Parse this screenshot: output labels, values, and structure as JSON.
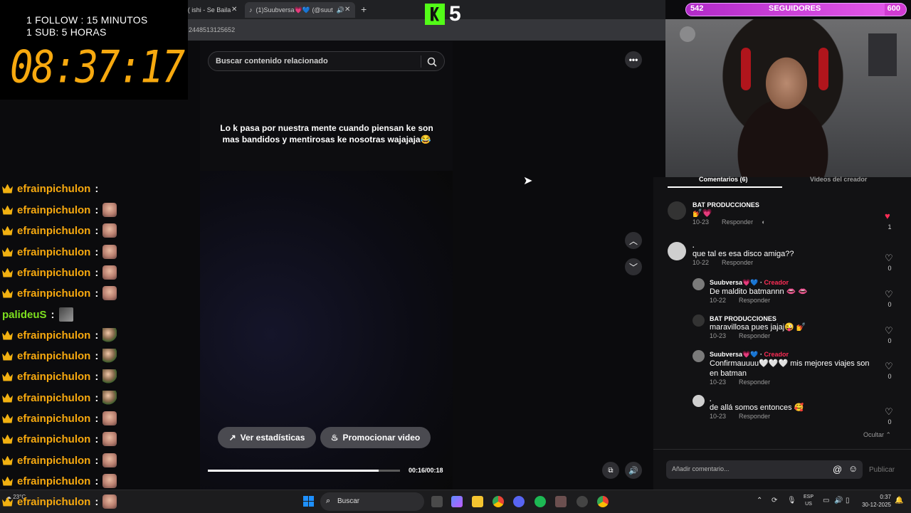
{
  "browser": {
    "tabs": [
      {
        "label": "( ishi - Se Baila"
      },
      {
        "label": "(1)Suubversa💗💙 (@suut"
      }
    ],
    "url": "2448513125652"
  },
  "overlay": {
    "rule1": "1 FOLLOW : 15 MINUTOS",
    "rule2": "1 SUB: 5 HORAS",
    "timer": "08:37:17",
    "kick_count": "5",
    "followers": {
      "current": "542",
      "label": "SEGUIDORES",
      "goal": "600",
      "progress": 0.903
    }
  },
  "video": {
    "search_placeholder": "Buscar contenido relacionado",
    "caption": "Lo k pasa por nuestra mente cuando piensan ke son mas bandidos y mentirosas ke nosotras wajajaja😂",
    "stats_button": "Ver estadísticas",
    "promote_button": "Promocionar video",
    "time": "00:16/00:18",
    "progress": 0.89
  },
  "comments_panel": {
    "tab_comments": "Comentarios (6)",
    "tab_creator_videos": "Videos del creador",
    "reply_label": "Responder",
    "creator_label": "Creador",
    "hide_label": "Ocultar",
    "add_placeholder": "Añadir comentario...",
    "publish_label": "Publicar",
    "items": [
      {
        "name": "BAT PRODUCCIONES",
        "text": "💅💗",
        "date": "10-23",
        "likes": "1",
        "liked": true
      },
      {
        "name": ".",
        "text": "que tal es esa disco amiga??",
        "date": "10-22",
        "likes": "0"
      },
      {
        "name": "Suubversa💗💙",
        "text": "De maldito batmannn 👄 👄",
        "date": "10-22",
        "likes": "0",
        "creator": true
      },
      {
        "name": "BAT PRODUCCIONES",
        "text": "maravillosa pues jajaj😜 💅",
        "date": "10-23",
        "likes": "0"
      },
      {
        "name": "Suubversa💗💙",
        "text": "Confirmauuuu🤍🤍🤍 mis mejores viajes son en batman",
        "date": "10-23",
        "likes": "0",
        "creator": true
      },
      {
        "name": ".",
        "text": "de allá somos entonces 🥰",
        "date": "10-23",
        "likes": "0"
      }
    ]
  },
  "chat": {
    "top_partial": "efrainpichulon",
    "messages": [
      {
        "user": "efrainpichulon"
      },
      {
        "user": "efrainpichulon"
      },
      {
        "user": "efrainpichulon"
      },
      {
        "user": "efrainpichulon"
      },
      {
        "user": "efrainpichulon"
      },
      {
        "user": "palideuS"
      },
      {
        "user": "efrainpichulon"
      },
      {
        "user": "efrainpichulon"
      },
      {
        "user": "efrainpichulon"
      },
      {
        "user": "efrainpichulon"
      },
      {
        "user": "efrainpichulon"
      },
      {
        "user": "efrainpichulon"
      },
      {
        "user": "efrainpichulon"
      },
      {
        "user": "efrainpichulon"
      },
      {
        "user": "efrainpichulon"
      }
    ],
    "colon": ":"
  },
  "taskbar": {
    "search": "Buscar",
    "weather": "23°C",
    "lang_top": "ESP",
    "lang_bottom": "US",
    "time": "0:37",
    "date": "30-12-2025"
  },
  "colors": {
    "accent_orange": "#f7a90f",
    "kick_green": "#53fc18",
    "tiktok_red": "#fe2c55",
    "followers_purple": "#d13bd3"
  }
}
